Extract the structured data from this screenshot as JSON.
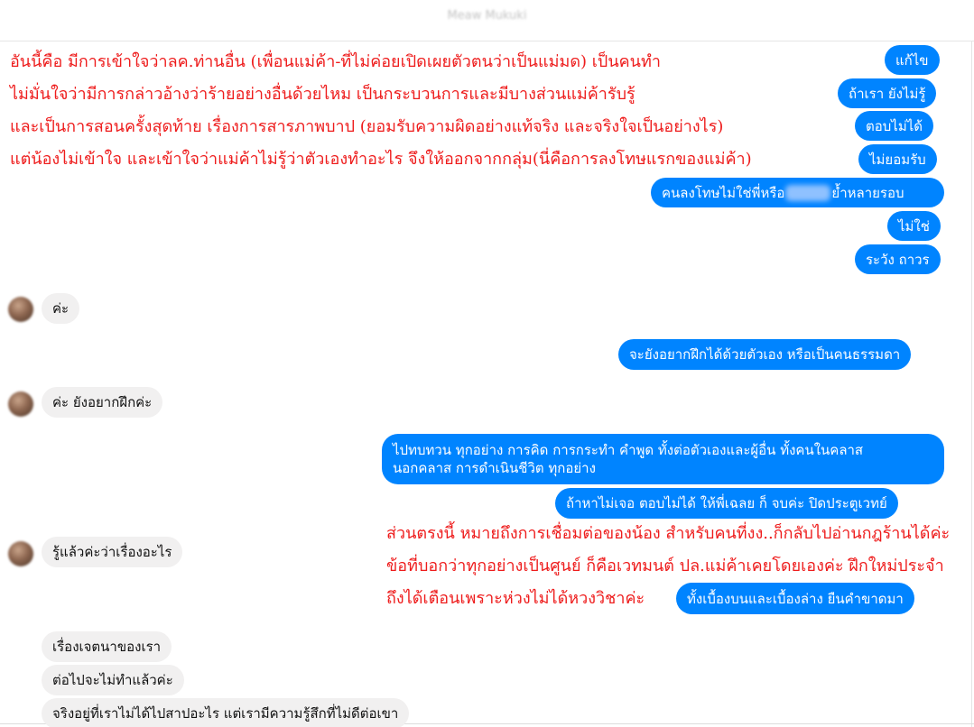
{
  "header": {
    "contact_name": "Meaw Mukuki"
  },
  "icons": {
    "avatar": "contact-avatar-blurred"
  },
  "colors": {
    "outgoing_bubble": "#0084ff",
    "incoming_bubble": "#f1f0f0",
    "annotation_text": "#ee1c1c"
  },
  "annotations": {
    "block1": [
      "อันนี้คือ มีการเข้าใจว่าลค.ท่านอื่น (เพื่อนแม่ค้า-ที่ไม่ค่อยเปิดเผยตัวตนว่าเป็นแม่มด) เป็นคนทำ",
      "ไม่มั่นใจว่ามีการกล่าวอ้างว่าร้ายอย่างอื่นด้วยไหม เป็นกระบวนการและมีบางส่วนแม่ค้ารับรู้",
      "และเป็นการสอนครั้งสุดท้าย เรื่องการสารภาพบาป (ยอมรับความผิดอย่างแท้จริง และจริงใจเป็นอย่างไร)",
      "แต่น้องไม่เข้าใจ และเข้าใจว่าแม่ค้าไม่รู้ว่าตัวเองทำอะไร จึงให้ออกจากกลุ่ม(นี่คือการลงโทษแรกของแม่ค้า)"
    ],
    "block2": [
      "ส่วนตรงนี้ หมายถึงการเชื่อมต่อของน้อง สำหรับคนที่งง..ก็กลับไปอ่านกฎร้านได้ค่ะ",
      "ข้อที่บอกว่าทุกอย่างเป็นศูนย์ ก็คือเวทมนต์ ปล.แม่ค้าเคยโดยเองค่ะ ฝึกใหม่ประจำ",
      "ถึงได้เตือนเพราะห่วงไม่ได้หวงวิชาค่ะ"
    ]
  },
  "messages": {
    "out1": "แก้ไข",
    "out2": "ถ้าเรา ยังไม่รู้",
    "out3": "ตอบไม่ได้",
    "out4": "ไม่ยอมรับ",
    "out5_start": "คนลงโทษไม่ใช่พี่หรือ",
    "out5_end": "ย้ำหลายรอบ",
    "out6": "ไม่ใช่",
    "out7": "ระวัง ถาวร",
    "in1": "ค่ะ",
    "out8": "จะยังอยากฝึกได้ด้วยตัวเอง หรือเป็นคนธรรมดา",
    "in2": "ค่ะ ยังอยากฝึกค่ะ",
    "out9_line1": "ไปทบทวน ทุกอย่าง การคิด การกระทำ คำพูด ทั้งต่อตัวเองและผู้อื่น ทั้งคนในคลาส",
    "out9_line2": "นอกคลาส การดำเนินชีวิต ทุกอย่าง",
    "out10": "ถ้าหาไม่เจอ ตอบไม่ได้ ให้พี่เฉลย ก็ จบค่ะ ปิดประตูเวทย์",
    "in3": "รู้แล้วค่ะว่าเรื่องอะไร",
    "out11": "ทั้งเบื้องบนและเบื้องล่าง ยืนคำขาดมา",
    "in4": "เรื่องเจตนาของเรา",
    "in5": "ต่อไปจะไม่ทำแล้วค่ะ",
    "in6": "จริงอยู่ที่เราไม่ได้ไปสาปอะไร แต่เรามีความรู้สึกที่ไม่ดีต่อเขา"
  }
}
